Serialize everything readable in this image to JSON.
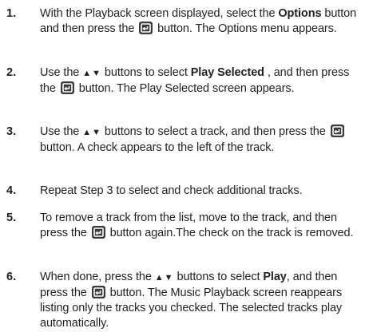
{
  "steps": [
    {
      "num": "1.",
      "parts": [
        {
          "t": "text",
          "v": "With the Playback screen displayed, select the "
        },
        {
          "t": "bold",
          "v": "Options"
        },
        {
          "t": "text",
          "v": " button and then press the "
        },
        {
          "t": "icon",
          "v": "enter-icon"
        },
        {
          "t": "text",
          "v": " button. The Options menu appears."
        }
      ]
    },
    {
      "num": "2.",
      "parts": [
        {
          "t": "text",
          "v": "Use the "
        },
        {
          "t": "arrows",
          "v": "▲▼"
        },
        {
          "t": "text",
          "v": " buttons to select "
        },
        {
          "t": "bold",
          "v": "Play Selected"
        },
        {
          "t": "text",
          "v": " , and then press the "
        },
        {
          "t": "icon",
          "v": "enter-icon"
        },
        {
          "t": "text",
          "v": " button. The Play Selected screen appears."
        }
      ]
    },
    {
      "num": "3.",
      "parts": [
        {
          "t": "text",
          "v": "Use the "
        },
        {
          "t": "arrows",
          "v": "▲▼"
        },
        {
          "t": "text",
          "v": " buttons to select a track, and then press the "
        },
        {
          "t": "icon",
          "v": "enter-icon"
        },
        {
          "t": "text",
          "v": " button. A check appears to the left of the track."
        }
      ]
    },
    {
      "num": "4.",
      "parts": [
        {
          "t": "text",
          "v": "Repeat Step 3 to select and check additional tracks."
        }
      ]
    },
    {
      "num": "5.",
      "parts": [
        {
          "t": "text",
          "v": "To remove a track from the list, move to the track, and then press the "
        },
        {
          "t": "icon",
          "v": "enter-icon"
        },
        {
          "t": "text",
          "v": " button again.The check on the track is removed."
        }
      ]
    },
    {
      "num": "6.",
      "parts": [
        {
          "t": "text",
          "v": "When done, press the "
        },
        {
          "t": "arrows",
          "v": "▲▼"
        },
        {
          "t": "text",
          "v": " buttons to select "
        },
        {
          "t": "bold",
          "v": "Play"
        },
        {
          "t": "text",
          "v": ", and then press the "
        },
        {
          "t": "icon",
          "v": "enter-icon"
        },
        {
          "t": "text",
          "v": " button. The Music Playback screen reappears listing only the tracks you checked. The selected tracks play automatically."
        }
      ]
    }
  ]
}
